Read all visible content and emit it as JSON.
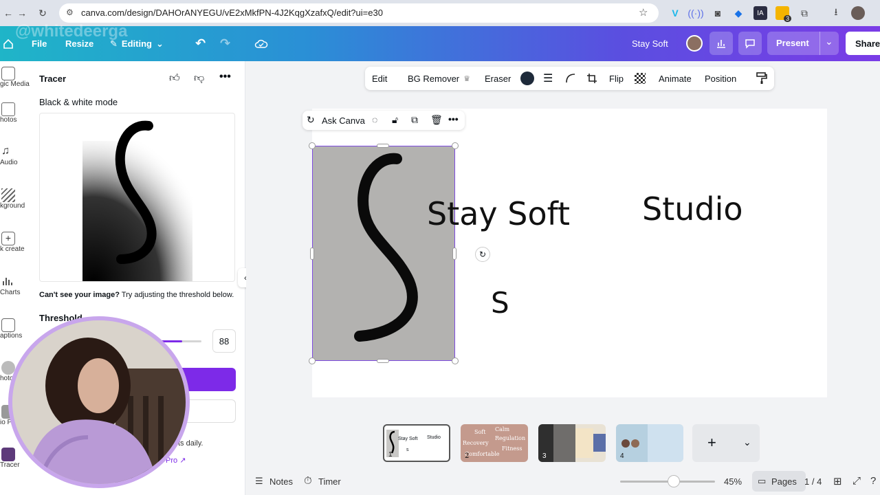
{
  "browser": {
    "url": "canva.com/design/DAHOrANYEGU/vE2xMkfPN-4J2KqgXzafxQ/edit?ui=e30",
    "extension_badge": "3"
  },
  "watermark": "@whitedeerga",
  "header": {
    "file_label": "File",
    "resize_label": "Resize",
    "editing_label": "Editing",
    "design_title": "Stay Soft",
    "present_label": "Present",
    "share_label": "Share"
  },
  "rail": {
    "items": [
      {
        "label": "gic Media"
      },
      {
        "label": "hotos"
      },
      {
        "label": "Audio"
      },
      {
        "label": "kground"
      },
      {
        "label": "k create"
      },
      {
        "label": "Charts"
      },
      {
        "label": "aptions"
      },
      {
        "label": "hoto"
      },
      {
        "label": "io P"
      },
      {
        "label": "Tracer"
      }
    ]
  },
  "panel": {
    "app_title": "Tracer",
    "mode_label": "Black & white mode",
    "hint_bold": "Can't see your image?",
    "hint_rest": " Try adjusting the threshold below.",
    "threshold_label": "Threshold",
    "threshold_value": "88",
    "threshold_fraction": 0.88,
    "footer_text": "ts daily.",
    "footer_link": "Pro"
  },
  "context_toolbar": {
    "edit": "Edit",
    "bg_remover": "BG Remover",
    "eraser": "Eraser",
    "flip": "Flip",
    "animate": "Animate",
    "position": "Position",
    "fill_color": "#1e2a3a"
  },
  "selection_toolbar": {
    "ask_canva": "Ask Canva"
  },
  "canvas": {
    "text_stay_soft": "Stay Soft",
    "text_studio": "Studio",
    "text_s": "S"
  },
  "thumbnails": [
    {
      "num": "1",
      "texts": [
        "Stay Soft",
        "Studio",
        "s"
      ]
    },
    {
      "num": "2",
      "texts": [
        "Soft",
        "Calm",
        "Recovery",
        "Regulation",
        "Comfortable",
        "Fitness"
      ]
    },
    {
      "num": "3",
      "texts": []
    },
    {
      "num": "4",
      "texts": []
    }
  ],
  "bottom": {
    "notes": "Notes",
    "timer": "Timer",
    "zoom": "45%",
    "pages": "Pages",
    "page_count": "1 / 4"
  },
  "colors": {
    "accent": "#7d2ae8",
    "selection": "#7d4ae0"
  }
}
